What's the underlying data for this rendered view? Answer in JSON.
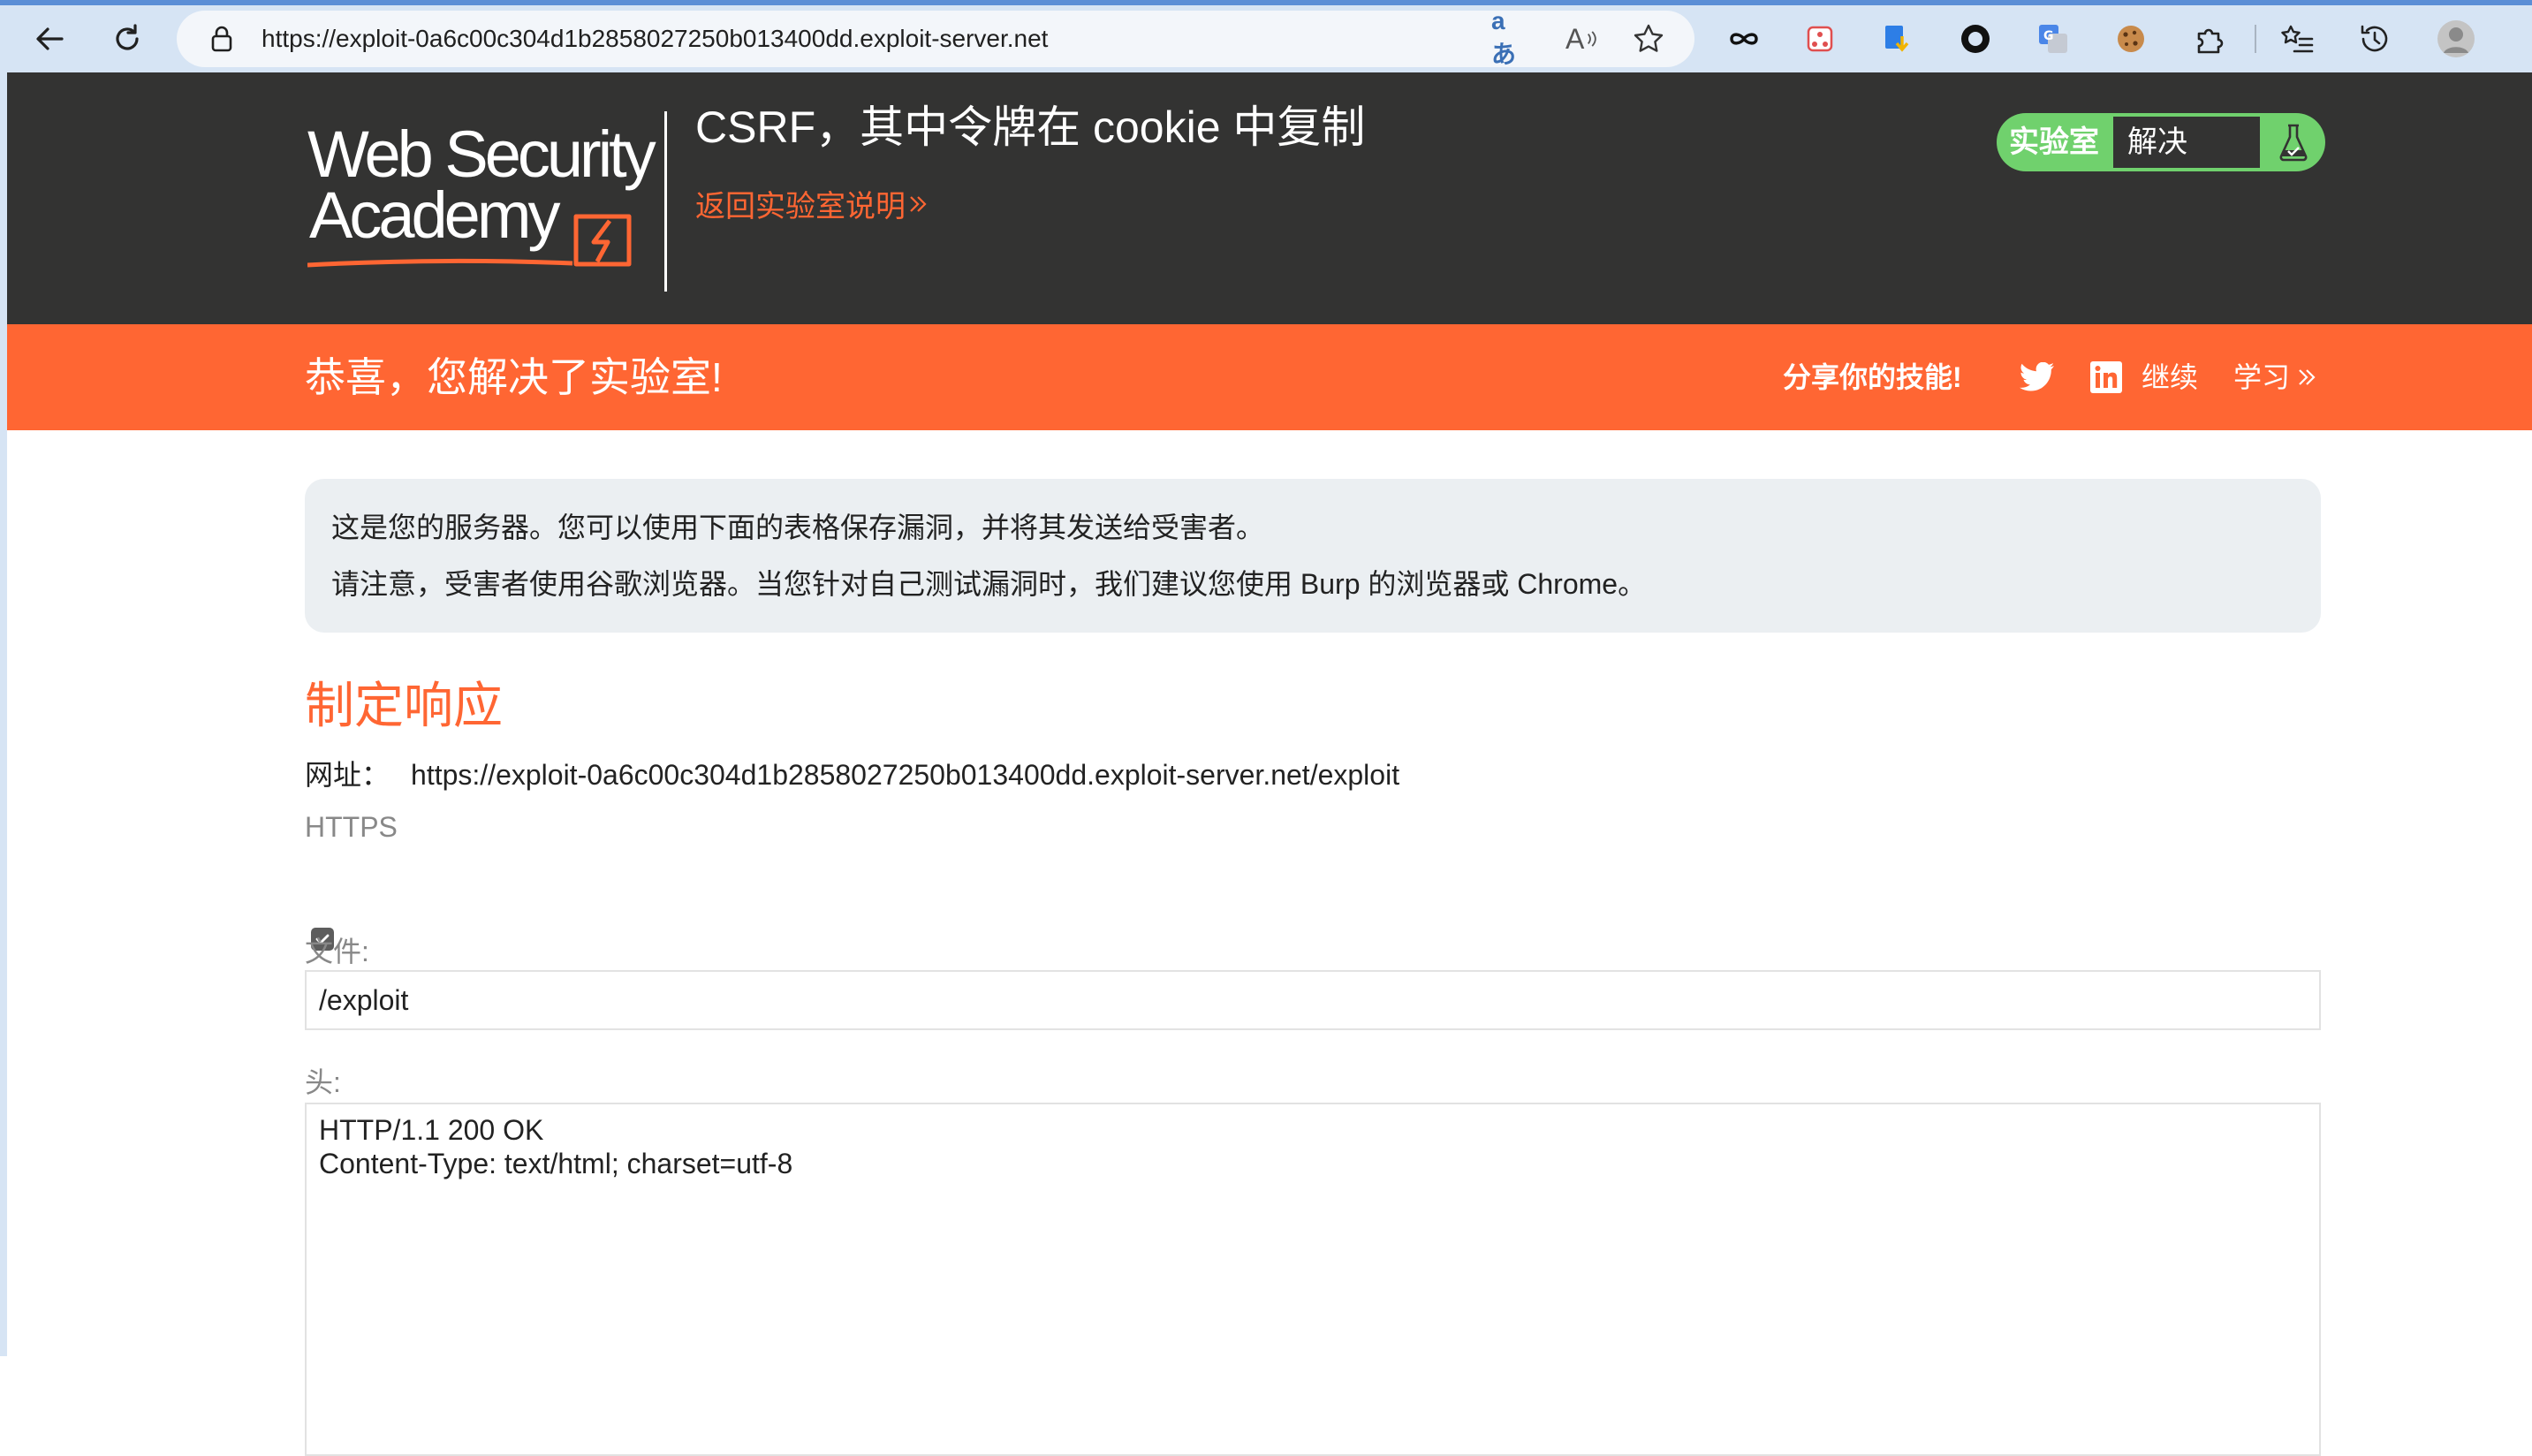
{
  "browser": {
    "url": "https://exploit-0a6c00c304d1b2858027250b013400dd.exploit-server.net",
    "translate_glyph": "aあ",
    "read_aloud_glyph": "A"
  },
  "header": {
    "logo_line1": "Web Security",
    "logo_line2": "Academy",
    "lab_title": "CSRF，其中令牌在 cookie 中复制",
    "back_link": "返回实验室说明",
    "status_label": "实验室",
    "status_value": "解决"
  },
  "banner": {
    "message": "恭喜，您解决了实验室!",
    "share": "分享你的技能!",
    "continue": "继续",
    "learn": "学习"
  },
  "content": {
    "info_line1": "这是您的服务器。您可以使用下面的表格保存漏洞，并将其发送给受害者。",
    "info_line2": "请注意，受害者使用谷歌浏览器。当您针对自己测试漏洞时，我们建议您使用 Burp 的浏览器或 Chrome。",
    "heading": "制定响应",
    "url_label": "网址：",
    "url_value": "https://exploit-0a6c00c304d1b2858027250b013400dd.exploit-server.net/exploit",
    "https_label": "HTTPS",
    "https_checked": true,
    "file_label": "文件:",
    "file_value": "/exploit",
    "head_label": "头:",
    "head_value": "HTTP/1.1 200 OK\nContent-Type: text/html; charset=utf-8"
  },
  "colors": {
    "orange": "#ff6633",
    "dark": "#333332",
    "green": "#70d16d",
    "info_bg": "#ebeff2"
  }
}
